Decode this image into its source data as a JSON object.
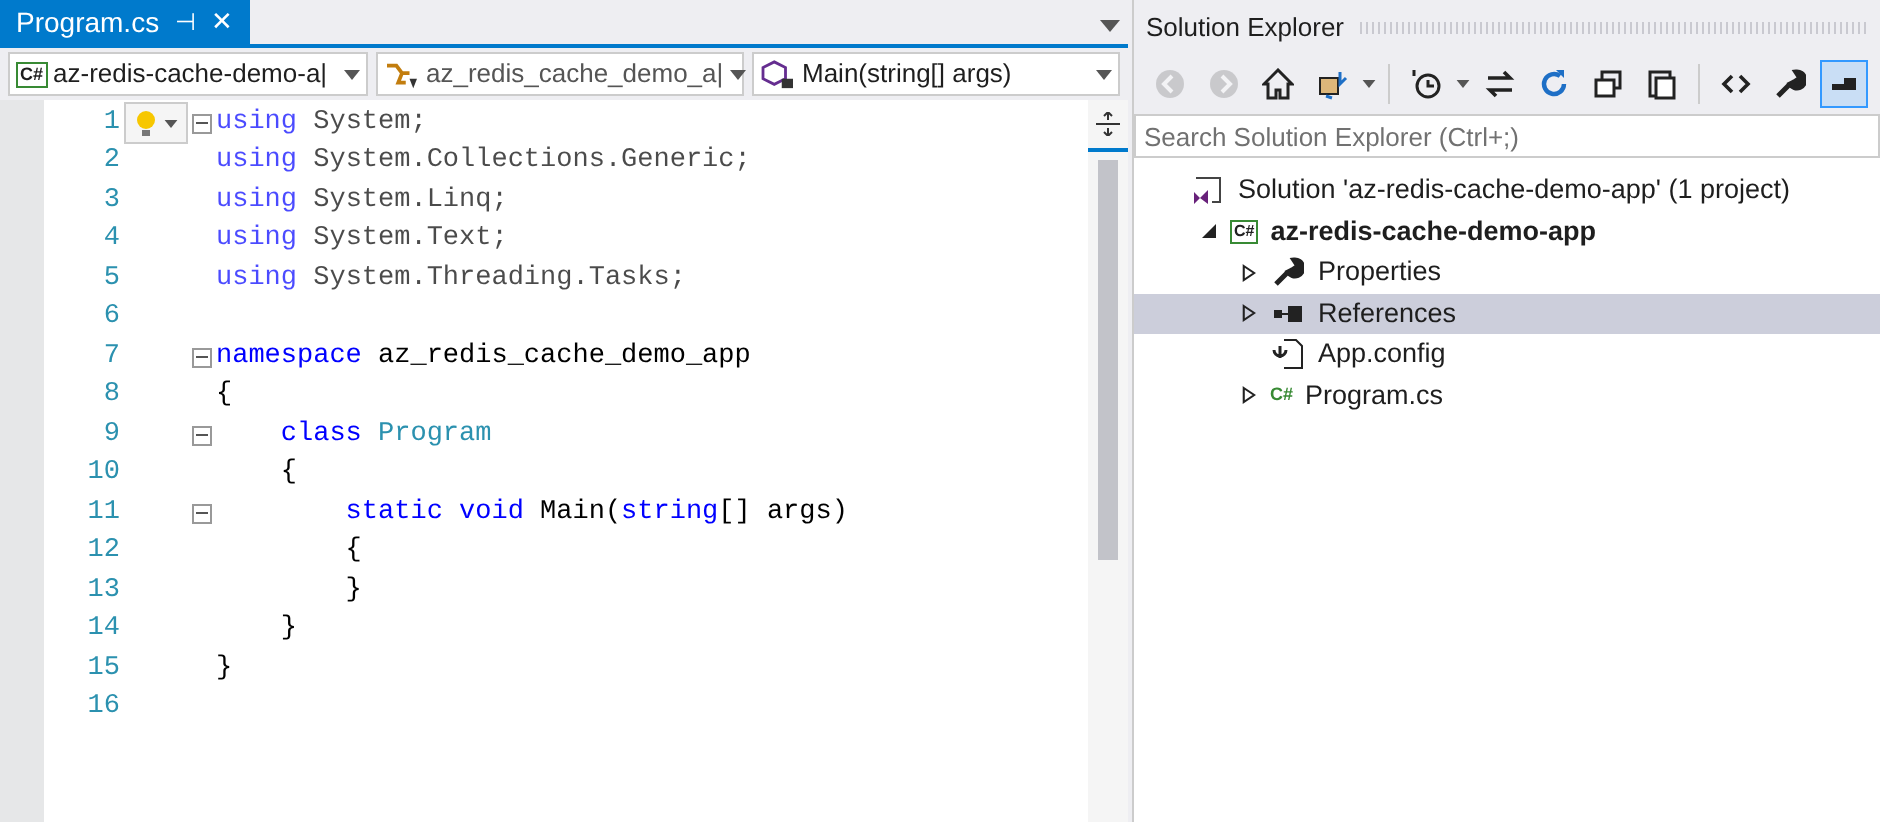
{
  "editor": {
    "tab": {
      "title": "Program.cs",
      "pin": "⊣",
      "close": "✕",
      "selected": true
    },
    "dropdowns": [
      {
        "kind": "project",
        "icon_text": "C#",
        "text": "az-redis-cache-demo-a|"
      },
      {
        "kind": "namespace",
        "text": "az_redis_cache_demo_a|"
      },
      {
        "kind": "method",
        "text": "Main(string[] args)"
      }
    ],
    "lines": [
      {
        "number": "1",
        "fold": true,
        "segments": [
          {
            "text": "using",
            "kind": "keyword"
          },
          {
            "text": " System;",
            "kind": "plain"
          }
        ]
      },
      {
        "number": "2",
        "fold": false,
        "segments": [
          {
            "text": "using",
            "kind": "keyword"
          },
          {
            "text": " System.Collections.Generic;",
            "kind": "plain"
          }
        ]
      },
      {
        "number": "3",
        "fold": false,
        "segments": [
          {
            "text": "using",
            "kind": "keyword"
          },
          {
            "text": " System.Linq;",
            "kind": "plain"
          }
        ]
      },
      {
        "number": "4",
        "fold": false,
        "segments": [
          {
            "text": "using",
            "kind": "keyword"
          },
          {
            "text": " System.Text;",
            "kind": "plain"
          }
        ]
      },
      {
        "number": "5",
        "fold": false,
        "segments": [
          {
            "text": "using",
            "kind": "keyword"
          },
          {
            "text": " System.Threading.Tasks;",
            "kind": "plain"
          }
        ]
      },
      {
        "number": "6",
        "fold": false
      },
      {
        "number": "7",
        "fold": true,
        "segments": [
          {
            "text": "namespace",
            "kind": "keyword"
          },
          {
            "text": " az_redis_cache_demo_app",
            "kind": "plain"
          }
        ]
      },
      {
        "number": "8",
        "fold": false,
        "segments": [
          {
            "text": "{",
            "kind": "plain"
          }
        ]
      },
      {
        "number": "9",
        "fold": true,
        "segments": [
          {
            "text": "    class",
            "kind": "keyword"
          },
          {
            "text": " Program",
            "kind": "type"
          }
        ]
      },
      {
        "number": "10",
        "fold": false,
        "segments": [
          {
            "text": "    {",
            "kind": "plain"
          }
        ]
      },
      {
        "number": "11",
        "fold": true,
        "segments": [
          {
            "text": "        static void",
            "kind": "keyword"
          },
          {
            "text": " Main(",
            "kind": "plain"
          },
          {
            "text": "string",
            "kind": "keyword"
          },
          {
            "text": "[] args)",
            "kind": "plain"
          }
        ]
      },
      {
        "number": "12",
        "fold": false,
        "segments": [
          {
            "text": "        {",
            "kind": "plain"
          }
        ]
      },
      {
        "number": "13",
        "fold": false,
        "segments": [
          {
            "text": "        }",
            "kind": "plain"
          }
        ]
      },
      {
        "number": "14",
        "fold": false,
        "segments": [
          {
            "text": "    }",
            "kind": "plain"
          }
        ]
      },
      {
        "number": "15",
        "fold": false,
        "segments": [
          {
            "text": "}",
            "kind": "plain"
          }
        ]
      },
      {
        "number": "16",
        "fold": false
      }
    ]
  },
  "solution_explorer": {
    "title": "Solution Explorer",
    "toolbar": [
      {
        "kind": "back",
        "disabled": true
      },
      {
        "kind": "forward",
        "disabled": true
      },
      {
        "kind": "home",
        "disabled": false
      },
      {
        "kind": "switch-views",
        "disabled": false
      },
      {
        "kind": "pending-changes",
        "disabled": false
      },
      {
        "kind": "sync",
        "disabled": false
      },
      {
        "kind": "refresh",
        "disabled": false
      },
      {
        "kind": "collapse-all",
        "disabled": false
      },
      {
        "kind": "show-all-files",
        "disabled": false
      },
      {
        "kind": "view-code",
        "disabled": false
      },
      {
        "kind": "properties",
        "disabled": false
      },
      {
        "kind": "preview",
        "disabled": false,
        "selected": true
      }
    ],
    "search": {
      "placeholder": "Search Solution Explorer (Ctrl+;)"
    },
    "tree": [
      {
        "label": "Solution 'az-redis-cache-demo-app' (1 project)",
        "kind": "solution",
        "has_children": false,
        "bold": false,
        "selected": false,
        "children": [
          {
            "label": "az-redis-cache-demo-app",
            "kind": "project",
            "icon_text": "C#",
            "has_children": true,
            "expanded": true,
            "bold": true,
            "selected": false,
            "children": [
              {
                "label": "Properties",
                "kind": "properties",
                "has_children": true,
                "expanded": false,
                "bold": false,
                "selected": false
              },
              {
                "label": "References",
                "kind": "references",
                "has_children": true,
                "expanded": false,
                "bold": false,
                "selected": true
              },
              {
                "label": "App.config",
                "kind": "config",
                "has_children": false,
                "bold": false,
                "selected": false
              },
              {
                "label": "Program.cs",
                "kind": "csfile",
                "icon_text": "C#",
                "has_children": true,
                "expanded": false,
                "bold": false,
                "selected": false
              }
            ]
          }
        ]
      }
    ]
  }
}
